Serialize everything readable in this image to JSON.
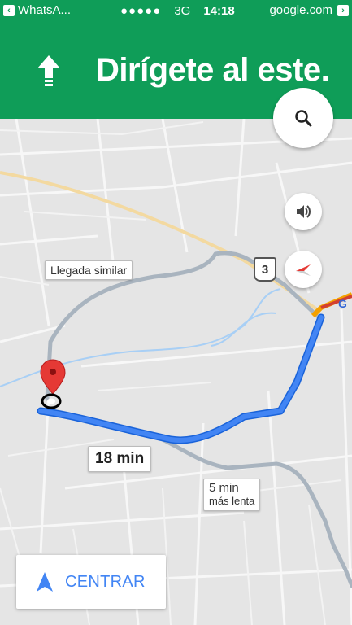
{
  "status_bar": {
    "back_app": "WhatsA...",
    "signal": "●●●●●",
    "network": "3G",
    "time": "14:18",
    "url": "google.com"
  },
  "navigation": {
    "instruction": "Dirígete al este.",
    "maneuver_icon": "straight-arrow-icon"
  },
  "map": {
    "route_labels": {
      "main": "18 min",
      "alt_similar": "Llegada similar",
      "alt_slower_time": "5 min",
      "alt_slower_note": "más lenta"
    },
    "road_shield": "3",
    "colors": {
      "header_green": "#0f9d58",
      "route_blue": "#4285f4",
      "alt_route_gray": "#a9b4bf",
      "pin_red": "#e53935"
    }
  },
  "controls": {
    "search_icon": "search-icon",
    "sound_icon": "speaker-icon",
    "compass_icon": "compass-icon",
    "center_label": "CENTRAR"
  }
}
